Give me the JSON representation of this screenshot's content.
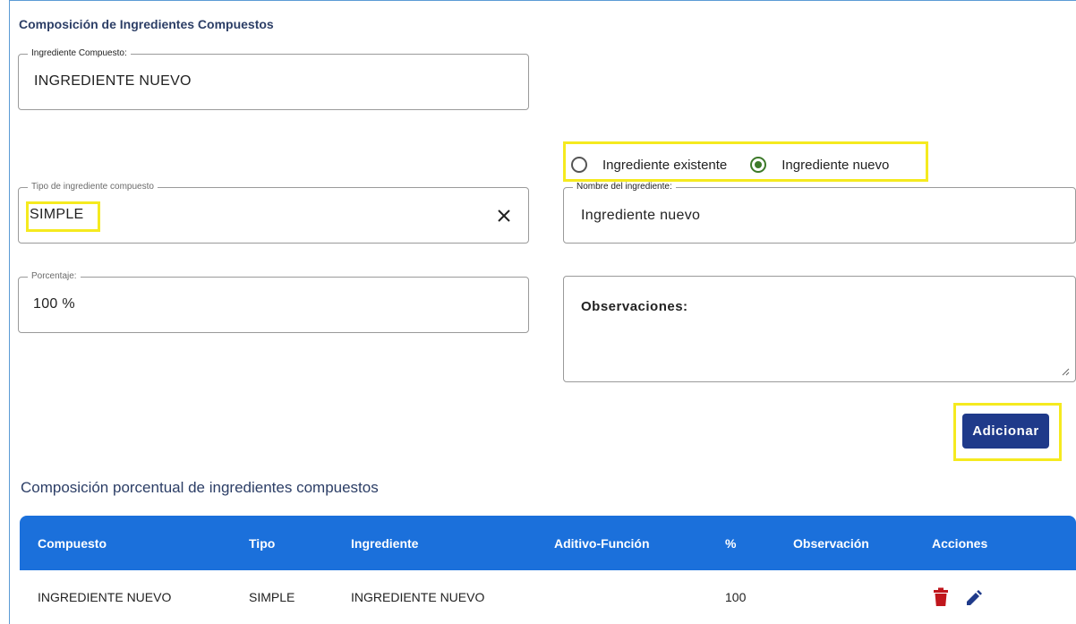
{
  "section_title": "Composición de Ingredientes Compuestos",
  "compound_field": {
    "label": "Ingrediente Compuesto:",
    "value": "INGREDIENTE NUEVO"
  },
  "type_field": {
    "label": "Tipo de ingrediente compuesto",
    "value": "SIMPLE"
  },
  "percent_field": {
    "label": "Porcentaje:",
    "value": "100 %"
  },
  "radio": {
    "existing_label": "Ingrediente existente",
    "new_label": "Ingrediente nuevo",
    "selected": "new"
  },
  "name_field": {
    "label": "Nombre del ingrediente:",
    "value": "Ingrediente nuevo"
  },
  "observations_field": {
    "label": "Observaciones:"
  },
  "add_button": "Adicionar",
  "table_title": "Composición porcentual de ingredientes compuestos",
  "table": {
    "headers": [
      "Compuesto",
      "Tipo",
      "Ingrediente",
      "Aditivo-Función",
      "%",
      "Observación",
      "Acciones"
    ],
    "rows": [
      {
        "compuesto": "INGREDIENTE NUEVO",
        "tipo": "SIMPLE",
        "ingrediente": "INGREDIENTE NUEVO",
        "aditivo": "",
        "porcentaje": "100",
        "observacion": ""
      }
    ]
  },
  "colors": {
    "accent": "#1b70db",
    "button": "#1f3a8a",
    "radio_selected": "#3d7a2a",
    "highlight": "#f5ea1f",
    "delete_icon": "#c0161c",
    "edit_icon": "#1f3a8a"
  },
  "icons": [
    "clear-icon",
    "radio-unchecked-icon",
    "radio-checked-icon",
    "resize-grip-icon",
    "trash-icon",
    "pencil-icon"
  ]
}
